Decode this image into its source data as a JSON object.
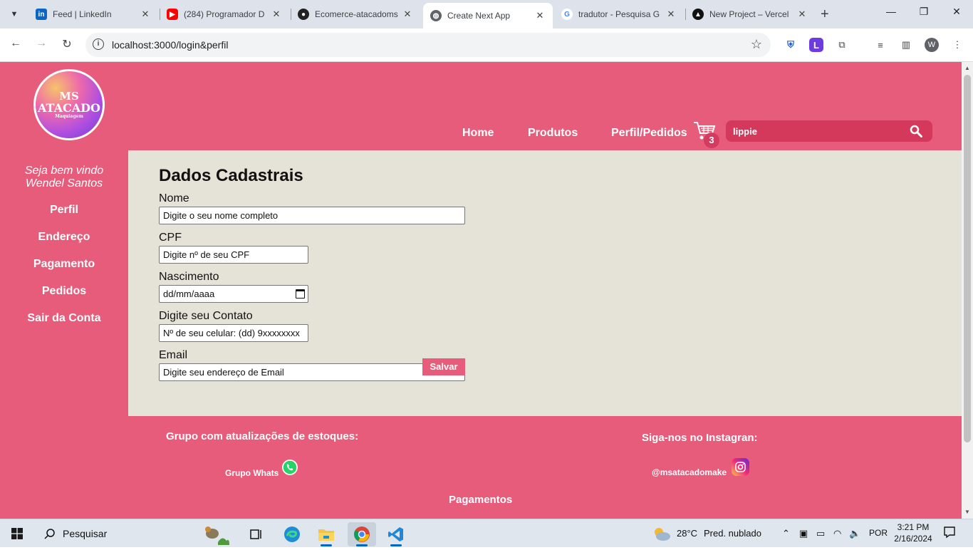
{
  "browser": {
    "tabs": [
      {
        "title": "Feed | LinkedIn",
        "icon": "linkedin-icon",
        "active": false
      },
      {
        "title": "(284) Programador D",
        "icon": "youtube-icon",
        "active": false
      },
      {
        "title": "Ecomerce-atacadoms",
        "icon": "github-icon",
        "active": false
      },
      {
        "title": "Create Next App",
        "icon": "globe-icon",
        "active": true
      },
      {
        "title": "tradutor - Pesquisa G",
        "icon": "google-icon",
        "active": false
      },
      {
        "title": "New Project – Vercel",
        "icon": "vercel-icon",
        "active": false
      }
    ],
    "url": "localhost:3000/login&perfil",
    "profile_initial": "W"
  },
  "site": {
    "logo": {
      "line1": "MS",
      "line2": "ATACADO",
      "line3": "Maquiagem"
    },
    "nav": {
      "home": "Home",
      "produtos": "Produtos",
      "perfil": "Perfil/Pedidos"
    },
    "cart_count": "3",
    "search_value": "lippie",
    "sidebar": {
      "welcome_line1": "Seja bem vindo",
      "welcome_line2": "Wendel Santos",
      "items": [
        "Perfil",
        "Endereço",
        "Pagamento",
        "Pedidos",
        "Sair da Conta"
      ]
    },
    "form": {
      "title": "Dados Cadastrais",
      "fields": [
        {
          "label": "Nome",
          "placeholder": "Digite o seu nome completo"
        },
        {
          "label": "CPF",
          "placeholder": "Digite nº de seu CPF"
        },
        {
          "label": "Nascimento",
          "placeholder": "dd/mm/aaaa"
        },
        {
          "label": "Digite seu Contato",
          "placeholder": "Nº de seu celular: (dd) 9xxxxxxxx"
        },
        {
          "label": "Email",
          "placeholder": "Digite seu endereço de Email"
        }
      ],
      "save_label": "Salvar"
    },
    "footer": {
      "group_heading": "Grupo com atualizações de estoques:",
      "group_link": "Grupo Whats",
      "insta_heading": "Siga-nos no Instagran:",
      "insta_link": "@msatacadomake",
      "payments": "Pagamentos"
    },
    "colors": {
      "brand_pink": "#e75c7b",
      "content_bg": "#e5e2d8",
      "search_bg": "#d4395c"
    }
  },
  "taskbar": {
    "search_label": "Pesquisar",
    "weather_temp": "28°C",
    "weather_desc": "Pred. nublado",
    "language": "POR",
    "time": "3:21 PM",
    "date": "2/16/2024"
  }
}
